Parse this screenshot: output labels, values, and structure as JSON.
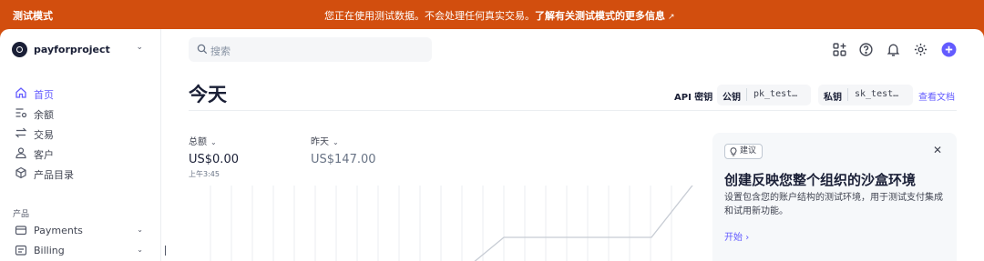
{
  "banner": {
    "mode_label": "测试模式",
    "message": "您正在使用测试数据。不会处理任何真实交易。",
    "link": "了解有关测试模式的更多信息"
  },
  "sidebar": {
    "account_name": "payforproject",
    "items": [
      {
        "label": "首页",
        "icon": "home-icon",
        "active": true
      },
      {
        "label": "余额",
        "icon": "balance-icon"
      },
      {
        "label": "交易",
        "icon": "transactions-icon"
      },
      {
        "label": "客户",
        "icon": "customer-icon"
      },
      {
        "label": "产品目录",
        "icon": "product-catalog-icon"
      }
    ],
    "section_label": "产品",
    "products": [
      {
        "label": "Payments",
        "icon": "payments-icon"
      },
      {
        "label": "Billing",
        "icon": "billing-icon"
      }
    ]
  },
  "header": {
    "search_placeholder": "搜索",
    "icons": [
      "apps-icon",
      "help-icon",
      "bell-icon",
      "gear-icon",
      "plus-icon"
    ]
  },
  "page": {
    "title": "今天",
    "api_label": "API 密钥",
    "public_key_label": "公钥",
    "public_key_value": "pk_test…",
    "secret_key_label": "私钥",
    "secret_key_value": "sk_test…",
    "docs_link": "查看文档"
  },
  "metrics": {
    "total_label": "总额",
    "total_value": "US$0.00",
    "total_time": "上午3:45",
    "yesterday_label": "昨天",
    "yesterday_value": "US$147.00"
  },
  "card": {
    "badge": "建议",
    "title": "创建反映您整个组织的沙盒环境",
    "description": "设置包含您的账户结构的测试环境，用于测试支付集成和试用新功能。",
    "link": "开始"
  },
  "colors": {
    "banner": "#d24e0e",
    "accent": "#635bff",
    "text": "#1a1f36"
  }
}
